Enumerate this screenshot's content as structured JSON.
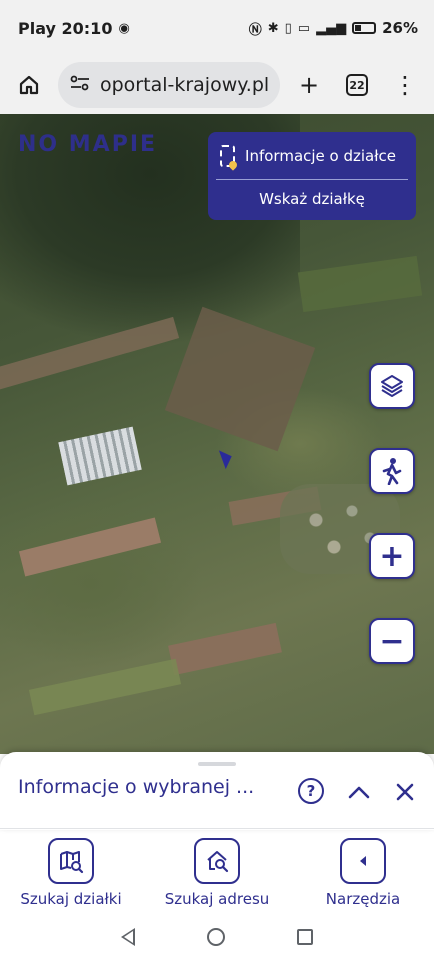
{
  "status_bar": {
    "carrier_time": "Play 20:10",
    "battery": "26%",
    "icons": [
      "nfc-icon",
      "bluetooth-icon",
      "vibrate-icon",
      "volte-icon",
      "lte-signal-icon",
      "battery-icon"
    ]
  },
  "browser": {
    "url": "oportal-krajowy.pl",
    "tab_count": "22",
    "icons": {
      "home": "home-icon",
      "site_settings": "tune-icon",
      "new_tab": "plus-icon",
      "menu": "more-vert-icon"
    }
  },
  "map": {
    "logo_text": "NO MAPIE",
    "info_card": {
      "title": "Informacje o działce",
      "link": "Wskaż działkę"
    },
    "controls": {
      "layers": "layers-icon",
      "street_view": "person-walk-icon",
      "zoom_in": "+",
      "zoom_out": "−"
    }
  },
  "panel": {
    "title": "Informacje o wybranej ...",
    "help": "?",
    "collapse": "^",
    "close": "✕"
  },
  "bottom_nav": {
    "items": [
      {
        "label": "Szukaj działki",
        "icon": "map-search-icon"
      },
      {
        "label": "Szukaj adresu",
        "icon": "home-search-icon"
      },
      {
        "label": "Narzędzia",
        "icon": "chevron-left-icon"
      }
    ]
  },
  "colors": {
    "brand": "#2f2f8e",
    "accent": "#e8a23a"
  }
}
